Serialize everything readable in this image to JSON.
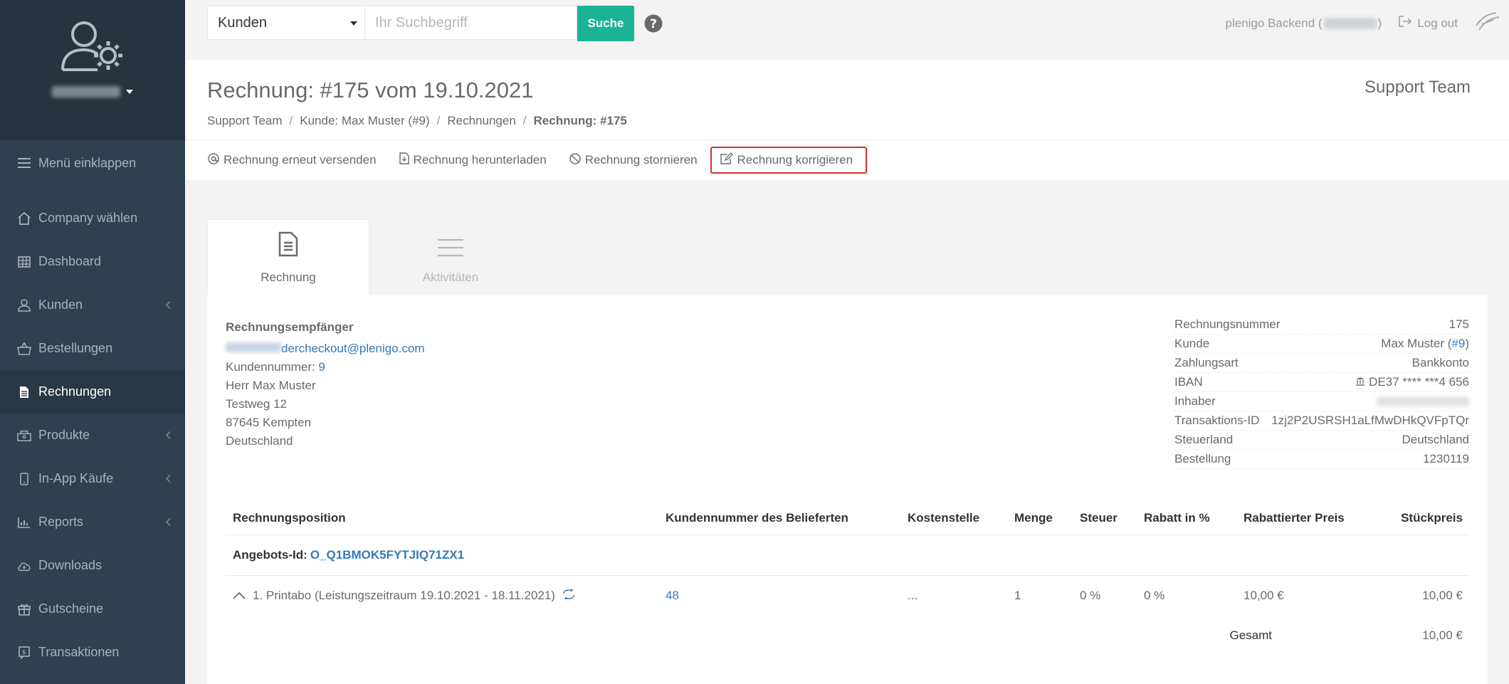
{
  "sidebar": {
    "username_blurred": "",
    "items": [
      {
        "label": "Menü einklappen",
        "icon": "hamburger-icon"
      },
      {
        "label": "Company wählen",
        "icon": "home-icon"
      },
      {
        "label": "Dashboard",
        "icon": "grid-icon"
      },
      {
        "label": "Kunden",
        "icon": "user-icon"
      },
      {
        "label": "Bestellungen",
        "icon": "basket-icon"
      },
      {
        "label": "Rechnungen",
        "icon": "invoice-icon"
      },
      {
        "label": "Produkte",
        "icon": "box-icon"
      },
      {
        "label": "In-App Käufe",
        "icon": "mobile-icon"
      },
      {
        "label": "Reports",
        "icon": "chart-icon"
      },
      {
        "label": "Downloads",
        "icon": "cloud-download-icon"
      },
      {
        "label": "Gutscheine",
        "icon": "gift-icon"
      },
      {
        "label": "Transaktionen",
        "icon": "transaction-icon"
      }
    ]
  },
  "topbar": {
    "search_scope": "Kunden",
    "search_placeholder": "Ihr Suchbegriff",
    "search_button": "Suche",
    "backend_label": "plenigo Backend (",
    "backend_label_close": ")",
    "logout": "Log out"
  },
  "header": {
    "title": "Rechnung: #175 vom 19.10.2021",
    "team": "Support Team",
    "breadcrumb": [
      "Support Team",
      "Kunde: Max Muster (#9)",
      "Rechnungen",
      "Rechnung: #175"
    ]
  },
  "actions": [
    {
      "label": "Rechnung erneut versenden",
      "icon": "at-icon"
    },
    {
      "label": "Rechnung herunterladen",
      "icon": "file-download-icon"
    },
    {
      "label": "Rechnung stornieren",
      "icon": "cancel-icon"
    },
    {
      "label": "Rechnung korrigieren",
      "icon": "edit-icon"
    }
  ],
  "tabs": [
    {
      "label": "Rechnung",
      "icon": "document-icon"
    },
    {
      "label": "Aktivitäten",
      "icon": "list-icon"
    }
  ],
  "recipient": {
    "heading": "Rechnungsempfänger",
    "email": "dercheckout@plenigo.com",
    "customer_number_label": "Kundennummer: ",
    "customer_number": "9",
    "name": "Herr Max Muster",
    "street": "Testweg 12",
    "city": "87645 Kempten",
    "country": "Deutschland"
  },
  "info": {
    "rows": [
      {
        "label": "Rechnungsnummer",
        "value": "175"
      },
      {
        "label": "Kunde",
        "value": "Max Muster (",
        "link": "#9",
        "suffix": ")"
      },
      {
        "label": "Zahlungsart",
        "value": "Bankkonto"
      },
      {
        "label": "IBAN",
        "value": "DE37 **** ***4 656"
      },
      {
        "label": "Inhaber",
        "value": ""
      },
      {
        "label": "Transaktions-ID",
        "link": "1zj2P2USRSH1aLfMwDHkQVFpTQr"
      },
      {
        "label": "Steuerland",
        "value": "Deutschland"
      },
      {
        "label": "Bestellung",
        "link": "1230119"
      }
    ]
  },
  "items": {
    "headers": [
      "Rechnungsposition",
      "Kundennummer des Belieferten",
      "Kostenstelle",
      "Menge",
      "Steuer",
      "Rabatt in %",
      "Rabattierter Preis",
      "Stückpreis"
    ],
    "offer_label": "Angebots-Id: ",
    "offer_id": "O_Q1BMOK5FYTJIQ71ZX1",
    "row": {
      "position": "1. Printabo (Leistungszeitraum 19.10.2021 - 18.11.2021)",
      "customer": "48",
      "cost_center": "...",
      "quantity": "1",
      "tax": "0 %",
      "discount": "0 %",
      "discounted_price": "10,00 €",
      "unit_price": "10,00 €"
    },
    "total_label": "Gesamt",
    "total_value": "10,00 €"
  }
}
